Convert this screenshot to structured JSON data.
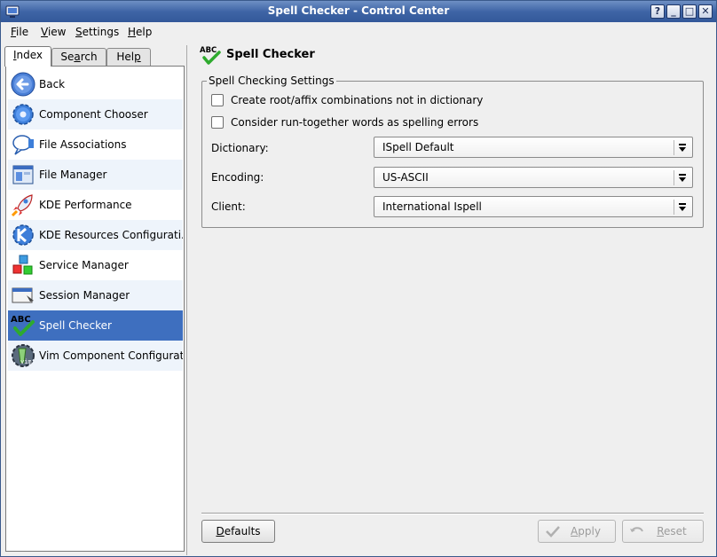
{
  "window": {
    "title": "Spell Checker - Control Center",
    "buttons": {
      "help": "?",
      "minimize": "_",
      "maximize": "□",
      "close": "✕"
    }
  },
  "menu": {
    "file": {
      "mnemonic": "F",
      "rest": "ile"
    },
    "view": {
      "mnemonic": "V",
      "rest": "iew"
    },
    "settings": {
      "mnemonic": "S",
      "rest": "ettings"
    },
    "help": {
      "mnemonic": "H",
      "rest": "elp"
    }
  },
  "sidebar": {
    "tabs": [
      {
        "label_mn": "I",
        "label_rest": "ndex"
      },
      {
        "label_pre": "Se",
        "label_mn": "a",
        "label_rest": "rch"
      },
      {
        "label_pre": "Hel",
        "label_mn": "p",
        "label_rest": ""
      }
    ],
    "items": [
      {
        "label": "Back",
        "icon": "back-arrow-icon"
      },
      {
        "label": "Component Chooser",
        "icon": "gear-icon"
      },
      {
        "label": "File Associations",
        "icon": "file-associations-icon"
      },
      {
        "label": "File Manager",
        "icon": "file-manager-icon"
      },
      {
        "label": "KDE Performance",
        "icon": "rocket-icon"
      },
      {
        "label": "KDE Resources Configurati...",
        "icon": "kde-resources-icon"
      },
      {
        "label": "Service Manager",
        "icon": "service-manager-icon"
      },
      {
        "label": "Session Manager",
        "icon": "session-manager-icon"
      },
      {
        "label": "Spell Checker",
        "icon": "spell-checker-icon"
      },
      {
        "label": "Vim Component Configurat...",
        "icon": "vim-component-icon"
      }
    ],
    "selected_index": 8
  },
  "module": {
    "title": "Spell Checker",
    "group_title": "Spell Checking Settings",
    "checkboxes": [
      {
        "label": "Create root/affix combinations not in dictionary",
        "checked": false
      },
      {
        "label": "Consider run-together words as spelling errors",
        "checked": false
      }
    ],
    "fields": [
      {
        "label": "Dictionary:",
        "value": "ISpell Default"
      },
      {
        "label": "Encoding:",
        "value": "US-ASCII"
      },
      {
        "label": "Client:",
        "value": "International Ispell"
      }
    ]
  },
  "buttons": {
    "defaults": {
      "mnemonic": "D",
      "rest": "efaults"
    },
    "apply": {
      "mnemonic": "A",
      "rest": "pply",
      "enabled": false
    },
    "reset": {
      "mnemonic": "R",
      "rest": "eset",
      "enabled": false
    }
  },
  "colors": {
    "title_bar": "#3f65a6",
    "selection": "#3e6fbf",
    "alt_row": "#eef4fb"
  }
}
